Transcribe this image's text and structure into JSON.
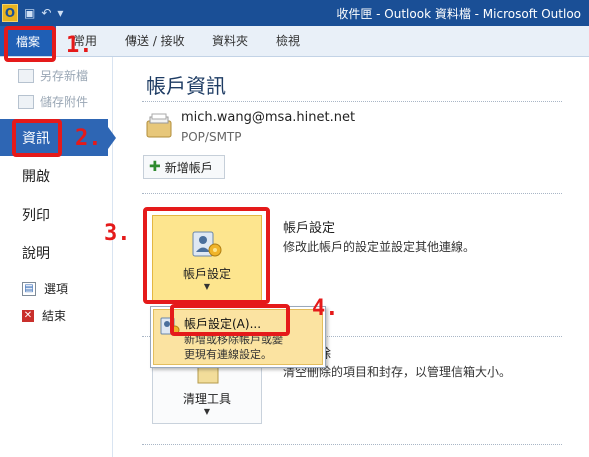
{
  "window": {
    "title": "收件匣 - Outlook 資料檔 - Microsoft Outloo",
    "app_icon_letter": "O"
  },
  "ribbon": {
    "tabs": [
      "檔案",
      "常用",
      "傳送 / 接收",
      "資料夾",
      "檢視"
    ]
  },
  "backstage": {
    "nav": {
      "small_items": [
        "另存新檔",
        "儲存附件"
      ],
      "items": [
        "資訊",
        "開啟",
        "列印",
        "說明"
      ],
      "selected": "資訊",
      "bottom_items": [
        "選項",
        "結束"
      ]
    }
  },
  "info": {
    "title": "帳戶資訊",
    "account": {
      "email": "mich.wang@msa.hinet.net",
      "type": "POP/SMTP"
    },
    "add_account_label": "新增帳戶",
    "account_settings": {
      "button_label": "帳戶設定",
      "title": "帳戶設定",
      "description": "修改此帳戶的設定並設定其他連線。"
    },
    "cleanup": {
      "button_label": "清理工具",
      "title_fragment": "除",
      "description": "清空刪除的項目和封存，以管理信箱大小。"
    }
  },
  "dropdown": {
    "item_label": "帳戶設定(A)...",
    "item_desc_line1": "新增或移除帳戶或變",
    "item_desc_line2": "更現有連線設定。"
  },
  "annotations": {
    "steps": [
      "1.",
      "2.",
      "3.",
      "4."
    ],
    "color": "#e51a1a"
  },
  "colors": {
    "titlebar": "#1a4f96",
    "file_tab": "#1f5fb5",
    "nav_selected": "#2e66b4",
    "highlight_button": "#fde58e"
  }
}
